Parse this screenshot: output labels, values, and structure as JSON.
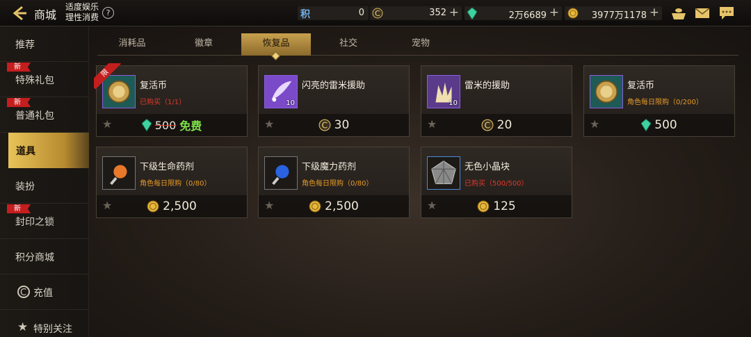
{
  "header": {
    "title": "商城",
    "notice_line1": "适度娱乐",
    "notice_line2": "理性消费",
    "help": "?",
    "currencies": [
      {
        "icon": "points-icon",
        "glyph": "积",
        "value": "0"
      },
      {
        "icon": "c-coin-icon",
        "value": "352",
        "plus": "+"
      },
      {
        "icon": "green-gem-icon",
        "value": "2万6689",
        "plus": "+"
      },
      {
        "icon": "gold-coin-icon",
        "value": "3977万1178",
        "plus": "+"
      }
    ]
  },
  "sidebar": {
    "items": [
      {
        "label": "推荐"
      },
      {
        "label": "特殊礼包",
        "badge": "新"
      },
      {
        "label": "普通礼包",
        "badge": "新"
      },
      {
        "label": "道具"
      },
      {
        "label": "装扮"
      },
      {
        "label": "封印之锁",
        "badge": "新"
      },
      {
        "label": "积分商城"
      },
      {
        "label": "充值"
      },
      {
        "label": "特别关注"
      }
    ]
  },
  "tabs": [
    {
      "label": "消耗品"
    },
    {
      "label": "徽章"
    },
    {
      "label": "恢复品"
    },
    {
      "label": "社交"
    },
    {
      "label": "宠物"
    }
  ],
  "cards": [
    {
      "name": "复活币",
      "sub": "已购买（1/1）",
      "old_price": "500",
      "price": "免费",
      "corner": "限"
    },
    {
      "name": "闪亮的雷米援助",
      "sub": "",
      "price": "30",
      "qty": "10"
    },
    {
      "name": "雷米的援助",
      "sub": "",
      "price": "20",
      "qty": "10"
    },
    {
      "name": "复活币",
      "sub": "角色每日限购（0/200）",
      "price": "500"
    },
    {
      "name": "下级生命药剂",
      "sub": "角色每日限购（0/80）",
      "price": "2,500"
    },
    {
      "name": "下级魔力药剂",
      "sub": "角色每日限购（0/80）",
      "price": "2,500"
    },
    {
      "name": "无色小晶块",
      "sub": "已购买（500/500）",
      "price": "125"
    }
  ],
  "colors": {
    "accent_gold": "#c9a14e",
    "sold_red": "#e03a2c",
    "limit_orange": "#e69a28",
    "free_green": "#7ee04a"
  }
}
